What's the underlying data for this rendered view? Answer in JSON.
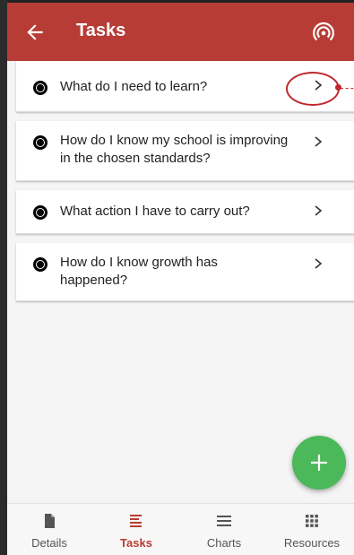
{
  "topbar": {
    "title": "Tasks",
    "back_icon": "arrow-left-icon",
    "right_icon": "broadcast-icon",
    "color": "#b73c36"
  },
  "tasks": [
    {
      "label": "What do I need to learn?"
    },
    {
      "label": "How do I know my school is improving in the chosen standards?"
    },
    {
      "label": "What action I have to carry out?"
    },
    {
      "label": "How do I know growth has happened?"
    }
  ],
  "fab": {
    "icon": "plus-icon",
    "color": "#4bb85a"
  },
  "bottom_nav": {
    "items": [
      {
        "label": "Details",
        "icon": "document-icon"
      },
      {
        "label": "Tasks",
        "icon": "list-icon",
        "active": true
      },
      {
        "label": "Charts",
        "icon": "menu-icon"
      },
      {
        "label": "Resources",
        "icon": "grid-icon"
      }
    ]
  }
}
